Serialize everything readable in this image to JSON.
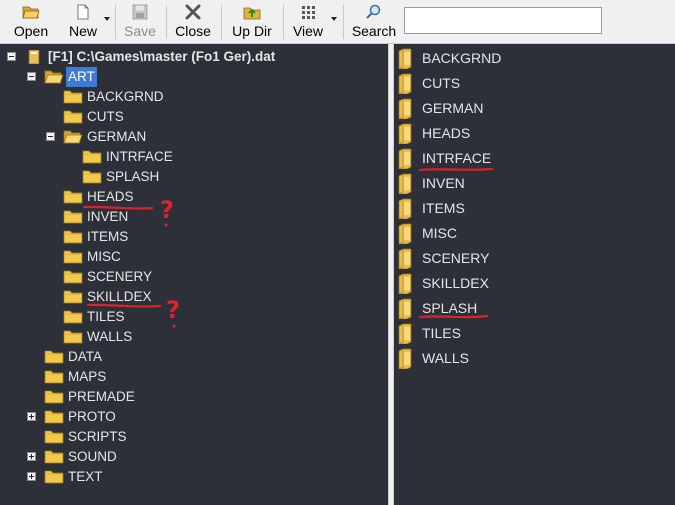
{
  "toolbar": {
    "open_label": "Open",
    "new_label": "New",
    "save_label": "Save",
    "close_label": "Close",
    "updir_label": "Up Dir",
    "view_label": "View",
    "search_label": "Search",
    "search_value": ""
  },
  "tree": {
    "root_label": "[F1] C:\\Games\\master (Fo1 Ger).dat",
    "art_label": "ART",
    "art_children": [
      "BACKGRND",
      "CUTS",
      "GERMAN",
      "HEADS",
      "INVEN",
      "ITEMS",
      "MISC",
      "SCENERY",
      "SKILLDEX",
      "TILES",
      "WALLS"
    ],
    "german_children": [
      "INTRFACE",
      "SPLASH"
    ],
    "top_level": [
      "DATA",
      "MAPS",
      "PREMADE",
      "PROTO",
      "SCRIPTS",
      "SOUND",
      "TEXT"
    ]
  },
  "file_list": {
    "items": [
      "BACKGRND",
      "CUTS",
      "GERMAN",
      "HEADS",
      "INTRFACE",
      "INVEN",
      "ITEMS",
      "MISC",
      "SCENERY",
      "SKILLDEX",
      "SPLASH",
      "TILES",
      "WALLS"
    ]
  },
  "annotations": {
    "heads_mark": "?",
    "skilldex_mark": "?"
  },
  "colors": {
    "background": "#2d3039",
    "selection": "#3d7bd4",
    "annotation": "#e0202a",
    "folder": "#f2c94c"
  }
}
